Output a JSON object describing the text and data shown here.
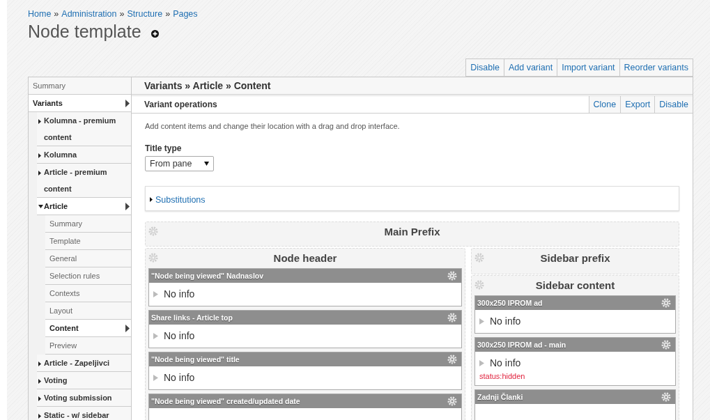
{
  "breadcrumbs": [
    "Home",
    "Administration",
    "Structure",
    "Pages"
  ],
  "breadcrumb_separator": "»",
  "page_title": "Node template",
  "top_actions": [
    "Disable",
    "Add variant",
    "Import variant",
    "Reorder variants"
  ],
  "sidebar": {
    "items": [
      {
        "label": "Summary",
        "selected": false
      },
      {
        "label": "Variants",
        "selected": true,
        "children": [
          {
            "label": "Kolumna - premium content",
            "selected": false,
            "expanded": false
          },
          {
            "label": "Kolumna",
            "selected": false,
            "expanded": false
          },
          {
            "label": "Article - premium content",
            "selected": false,
            "expanded": false
          },
          {
            "label": "Article",
            "selected": true,
            "expanded": true,
            "children": [
              {
                "label": "Summary",
                "selected": false
              },
              {
                "label": "Template",
                "selected": false
              },
              {
                "label": "General",
                "selected": false
              },
              {
                "label": "Selection rules",
                "selected": false
              },
              {
                "label": "Contexts",
                "selected": false
              },
              {
                "label": "Layout",
                "selected": false
              },
              {
                "label": "Content",
                "selected": true
              },
              {
                "label": "Preview",
                "selected": false
              }
            ]
          },
          {
            "label": "Article - Zapeljivci",
            "selected": false,
            "expanded": false
          },
          {
            "label": "Voting",
            "selected": false,
            "expanded": false
          },
          {
            "label": "Voting submission",
            "selected": false,
            "expanded": false
          },
          {
            "label": "Static - w/ sidebar",
            "selected": false,
            "expanded": false
          }
        ]
      }
    ]
  },
  "panel_title": "Variants » Article » Content",
  "operations": {
    "title": "Variant operations",
    "actions": [
      "Clone",
      "Export",
      "Disable"
    ]
  },
  "description": "Add content items and change their location with a drag and drop interface.",
  "title_type": {
    "label": "Title type",
    "value": "From pane"
  },
  "substitutions": {
    "label": "Substitutions",
    "expanded": false
  },
  "main_prefix": {
    "title": "Main Prefix"
  },
  "left_regions": [
    {
      "title": "Node header",
      "panes": [
        {
          "title": "\"Node being viewed\" Nadnaslov",
          "body": "No info"
        },
        {
          "title": "Share links - Article top",
          "body": "No info"
        },
        {
          "title": "\"Node being viewed\" title",
          "body": "No info"
        },
        {
          "title": "\"Node being viewed\" created/updated date"
        }
      ]
    }
  ],
  "right_regions": [
    {
      "title": "Sidebar prefix"
    },
    {
      "title": "Sidebar content",
      "panes": [
        {
          "title": "300x250 IPROM ad",
          "body": "No info"
        },
        {
          "title": "300x250 IPROM ad - main",
          "body": "No info",
          "status": "status:hidden"
        },
        {
          "title": "Zadnji Članki"
        }
      ]
    }
  ]
}
